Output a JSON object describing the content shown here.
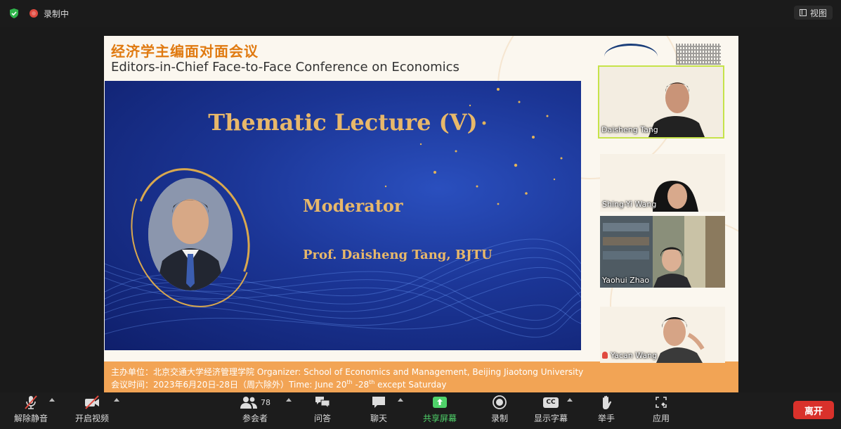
{
  "topbar": {
    "recording_label": "录制中",
    "view_label": "视图"
  },
  "slide": {
    "title_cn": "经济学主编面对面会议",
    "title_en": "Editors-in-Chief Face-to-Face Conference on Economics",
    "heading": "Thematic Lecture (V)",
    "moderator_label": "Moderator",
    "moderator_name": "Prof. Daisheng Tang, BJTU",
    "banner_line1": "主办单位：北京交通大学经济管理学院 Organizer: School of Economics and Management, Beijing Jiaotong University",
    "banner_line2_prefix": "会议时间：2023年6月20日-28日（周六除外）Time: June 20",
    "banner_line2_sup1": "th",
    "banner_line2_mid": " -28",
    "banner_line2_sup2": "th",
    "banner_line2_suffix": " except Saturday"
  },
  "participants": [
    {
      "name": "Daisheng Tang",
      "active_speaker": true
    },
    {
      "name": "Shing-Yi Wang"
    },
    {
      "name": "Yaohui Zhao"
    },
    {
      "name": "Yacan Wang",
      "muted": true
    }
  ],
  "toolbar": {
    "unmute": "解除静音",
    "start_video": "开启视频",
    "participants": "参会者",
    "participant_count": "78",
    "qa": "问答",
    "chat": "聊天",
    "share": "共享屏幕",
    "record": "录制",
    "captions": "显示字幕",
    "captions_icon_text": "CC",
    "raise_hand": "举手",
    "apps": "应用",
    "leave": "离开"
  },
  "colors": {
    "share_green": "#4fd26a",
    "leave_red": "#d9312b",
    "slide_gold": "#e8b86a",
    "active_speaker_border": "#c6e34a"
  }
}
